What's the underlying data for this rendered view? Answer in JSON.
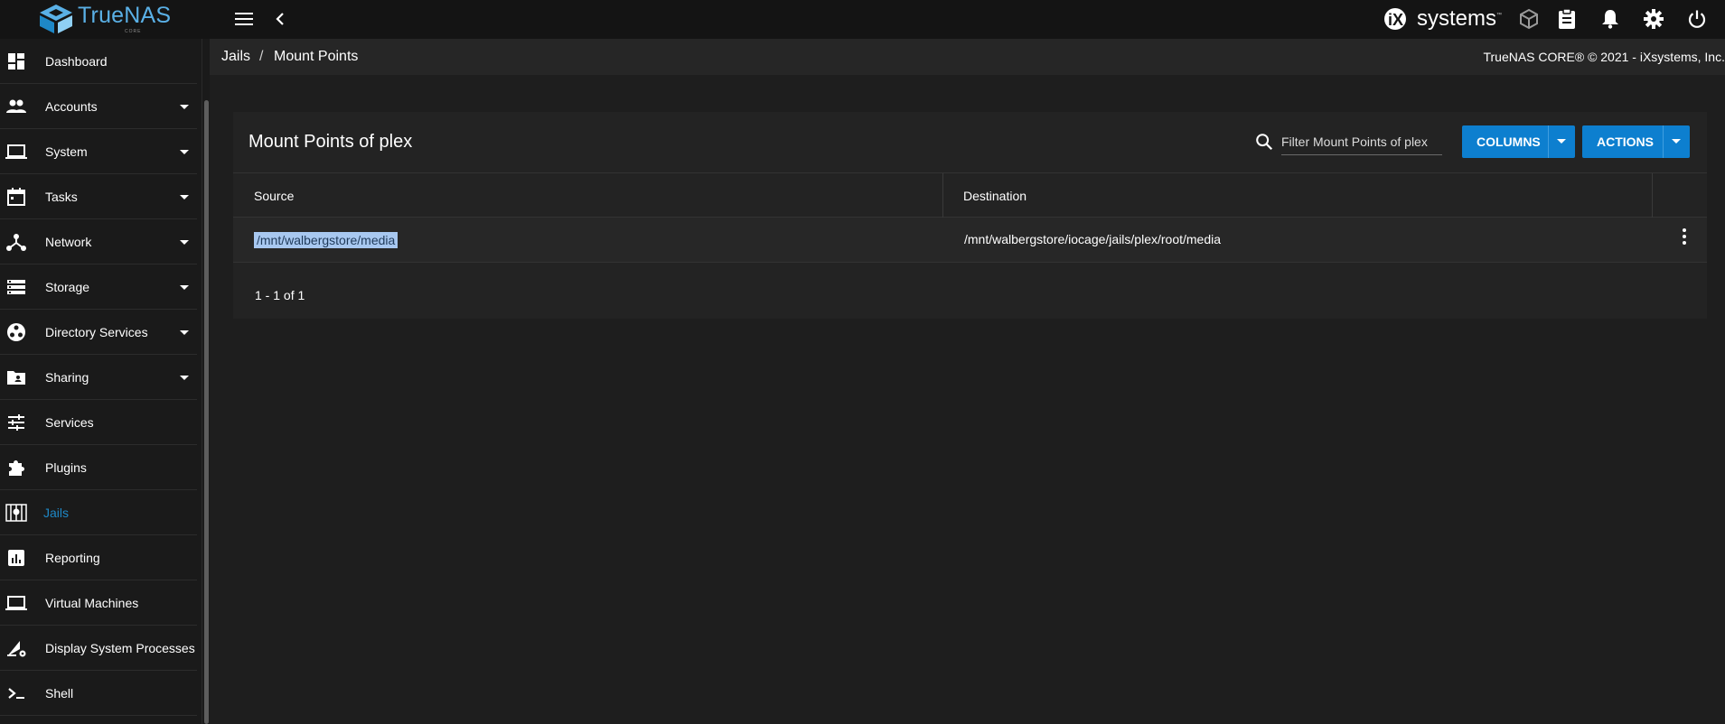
{
  "topbar": {
    "brand": "TrueNAS",
    "brand_sub": "CORE",
    "vendor_logo_text": "systems",
    "vendor_tm": "™",
    "icons": [
      "menu-icon",
      "back-arrow-icon",
      "truecommand-icon",
      "task-manager-icon",
      "notifications-icon",
      "settings-icon",
      "power-icon"
    ]
  },
  "breadcrumb": {
    "items": [
      "Jails",
      "Mount Points"
    ],
    "separator": "/",
    "copyright": "TrueNAS CORE® © 2021 - iXsystems, Inc."
  },
  "sidebar": {
    "items": [
      {
        "label": "Dashboard",
        "icon": "dashboard-icon",
        "expandable": false
      },
      {
        "label": "Accounts",
        "icon": "accounts-icon",
        "expandable": true
      },
      {
        "label": "System",
        "icon": "laptop-icon",
        "expandable": true
      },
      {
        "label": "Tasks",
        "icon": "calendar-icon",
        "expandable": true
      },
      {
        "label": "Network",
        "icon": "network-icon",
        "expandable": true
      },
      {
        "label": "Storage",
        "icon": "storage-icon",
        "expandable": true
      },
      {
        "label": "Directory Services",
        "icon": "directory-services-icon",
        "expandable": true
      },
      {
        "label": "Sharing",
        "icon": "sharing-folder-icon",
        "expandable": true
      },
      {
        "label": "Services",
        "icon": "services-sliders-icon",
        "expandable": false
      },
      {
        "label": "Plugins",
        "icon": "puzzle-icon",
        "expandable": false
      },
      {
        "label": "Jails",
        "icon": "jail-icon",
        "expandable": false,
        "active": true
      },
      {
        "label": "Reporting",
        "icon": "reporting-chart-icon",
        "expandable": false
      },
      {
        "label": "Virtual Machines",
        "icon": "laptop-icon",
        "expandable": false
      },
      {
        "label": "Display System Processes",
        "icon": "processes-icon",
        "expandable": false
      },
      {
        "label": "Shell",
        "icon": "shell-icon",
        "expandable": false
      }
    ]
  },
  "card": {
    "title": "Mount Points of plex",
    "filter_placeholder": "Filter Mount Points of plex",
    "columns_button": "COLUMNS",
    "actions_button": "ACTIONS",
    "table": {
      "headers": [
        "Source",
        "Destination"
      ],
      "rows": [
        {
          "source": "/mnt/walbergstore/media",
          "destination": "/mnt/walbergstore/iocage/jails/plex/root/media"
        }
      ]
    },
    "pagination": "1 - 1 of 1"
  },
  "colors": {
    "accent": "#0d7fcf",
    "active_nav": "#1e88c7",
    "background": "#1e1e1e",
    "topbar": "#141414"
  }
}
